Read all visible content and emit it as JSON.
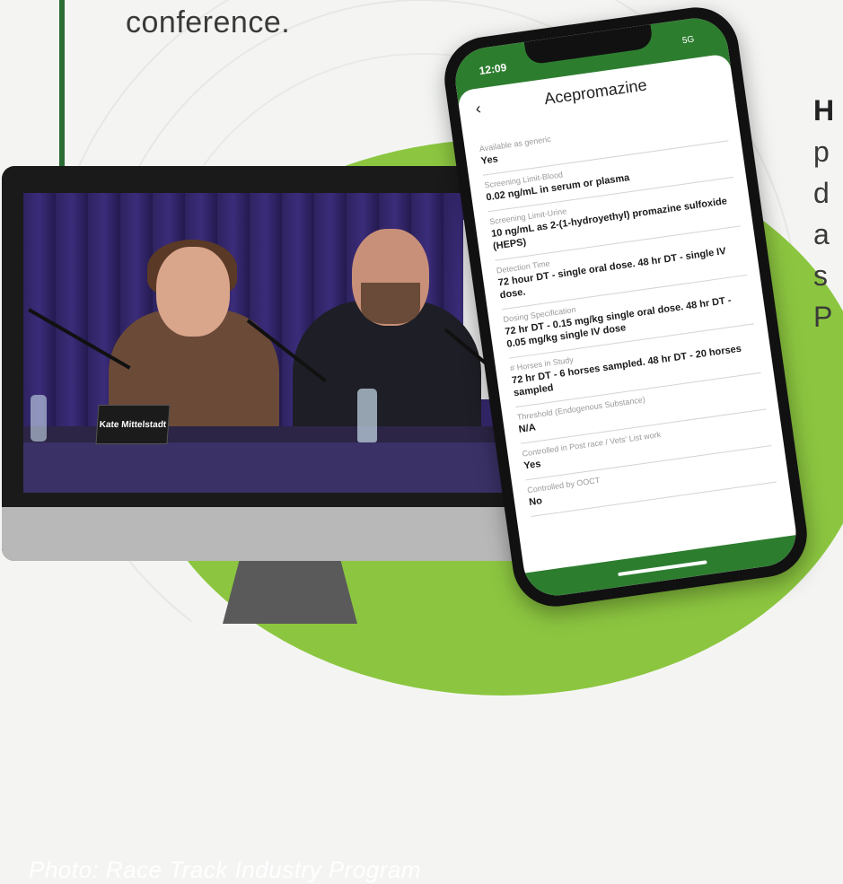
{
  "intro": {
    "text": "conference."
  },
  "right_column": {
    "lines": [
      "H",
      "p",
      "d",
      "a",
      "s",
      "P"
    ]
  },
  "monitor": {
    "photo_credit": "Photo: Race Track Industry Program",
    "name_card": "Kate Mittelstadt"
  },
  "phone": {
    "status_time": "12:09",
    "status_network": "5G",
    "back_icon": "chevron-left-icon",
    "title": "Acepromazine",
    "fields": [
      {
        "label": "Available as generic",
        "value": "Yes"
      },
      {
        "label": "Screening Limit-Blood",
        "value": "0.02 ng/mL in serum or plasma"
      },
      {
        "label": "Screening Limit-Urine",
        "value": "10 ng/mL as 2-(1-hydroyethyl) promazine sulfoxide (HEPS)"
      },
      {
        "label": "Detection Time",
        "value": "72 hour DT - single oral dose. 48 hr DT - single IV dose."
      },
      {
        "label": "Dosing Specification",
        "value": "72 hr DT - 0.15 mg/kg single oral dose. 48 hr DT - 0.05 mg/kg single IV dose"
      },
      {
        "label": "# Horses in Study",
        "value": "72 hr DT - 6 horses sampled. 48 hr DT - 20 horses sampled"
      },
      {
        "label": "Threshold (Endogenous Substance)",
        "value": "N/A"
      },
      {
        "label": "Controlled in Post race / Vets' List work",
        "value": "Yes"
      },
      {
        "label": "Controlled by OOCT",
        "value": "No"
      }
    ]
  },
  "colors": {
    "brand_green": "#2d7d2f",
    "blob_green": "#8cc640"
  }
}
